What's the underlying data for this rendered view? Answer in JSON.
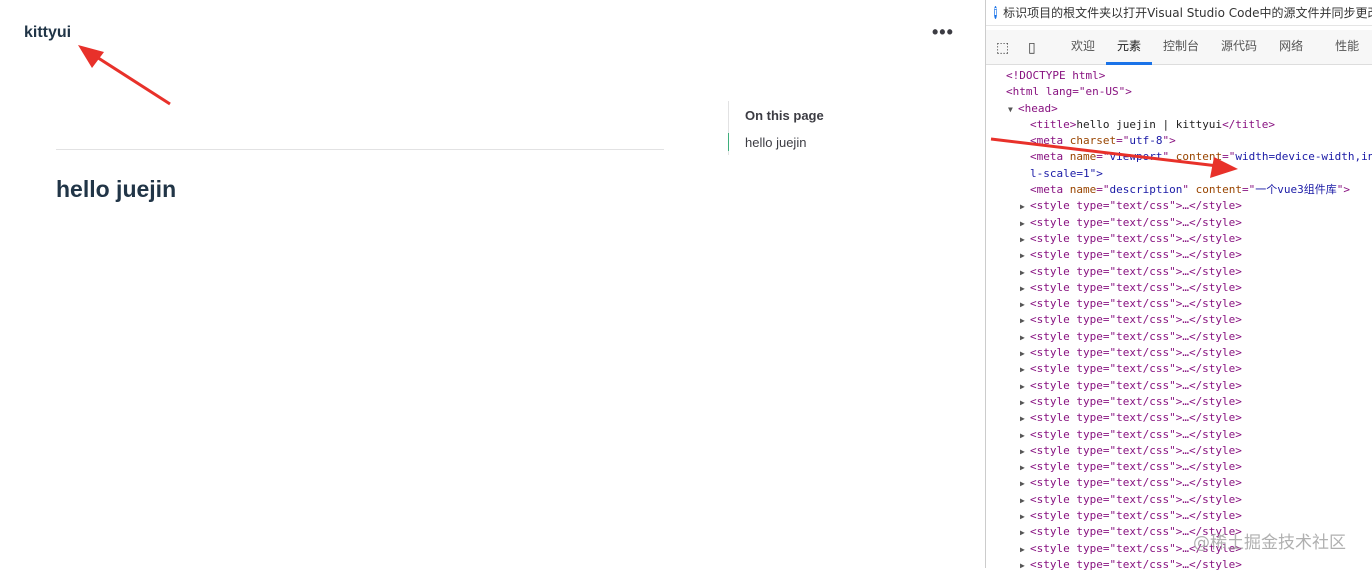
{
  "page": {
    "brand": "kittyui",
    "more_label": "•••",
    "heading": "hello juejin",
    "outline_title": "On this page",
    "outline_links": [
      "hello juejin"
    ]
  },
  "devtools": {
    "info_text": "标识项目的根文件夹以打开Visual Studio Code中的源文件并同步更改",
    "tabs": [
      "欢迎",
      "元素",
      "控制台",
      "源代码",
      "网络",
      "性能"
    ],
    "active_tab": "元素",
    "tree": {
      "doctype": "<!DOCTYPE html>",
      "html_open": "<html lang=\"en-US\">",
      "head_open": "<head>",
      "title": "hello juejin | kittyui",
      "meta_charset": "utf-8",
      "meta_viewport_content": "width=device-width,in",
      "meta_viewport_wrap": "l-scale=1\">",
      "meta_description_content": "一个vue3组件库",
      "style_line": "<style type=\"text/css\">…</style>",
      "style_count": 23
    }
  },
  "watermark": "@稀土掘金技术社区",
  "colors": {
    "arrow": "#e8312a",
    "accent": "#1a73e8"
  }
}
